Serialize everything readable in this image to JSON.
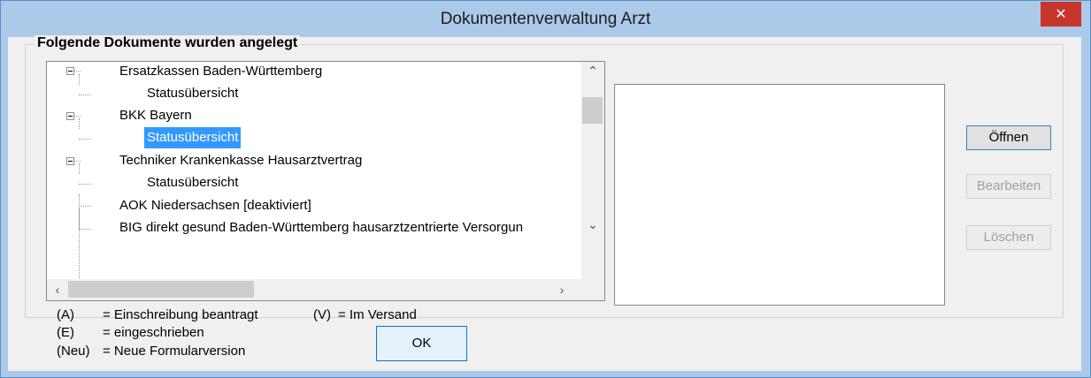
{
  "window": {
    "title": "Dokumentenverwaltung Arzt",
    "close_label": "✕"
  },
  "group": {
    "label": "Folgende Dokumente wurden angelegt"
  },
  "tree": {
    "rows": [
      {
        "label": "Ersatzkassen Baden-Württemberg",
        "level": 0,
        "expanded": true
      },
      {
        "label": "Statusübersicht",
        "level": 1,
        "selected": false
      },
      {
        "label": "BKK Bayern",
        "level": 0,
        "expanded": true
      },
      {
        "label": "Statusübersicht",
        "level": 1,
        "selected": true
      },
      {
        "label": "Techniker Krankenkasse Hausarztvertrag",
        "level": 0,
        "expanded": true
      },
      {
        "label": "Statusübersicht",
        "level": 1,
        "selected": false
      },
      {
        "label": "AOK Niedersachsen [deaktiviert]",
        "level": 0
      },
      {
        "label": "BIG direkt gesund Baden-Württemberg hausarztzentrierte Versorgun",
        "level": 0
      }
    ]
  },
  "buttons": {
    "open": "Öffnen",
    "edit": "Bearbeiten",
    "delete": "Löschen",
    "ok": "OK"
  },
  "legend": {
    "a_key": "(A)",
    "a_text": "= Einschreibung beantragt",
    "v_key": "(V)",
    "v_text": "= Im Versand",
    "e_key": "(E)",
    "e_text": "= eingeschrieben",
    "neu_key": "(Neu)",
    "neu_text": "= Neue Formularversion"
  },
  "colors": {
    "title_bar": "#abc9e8",
    "close_button": "#c7362c",
    "selection": "#3399ff"
  }
}
